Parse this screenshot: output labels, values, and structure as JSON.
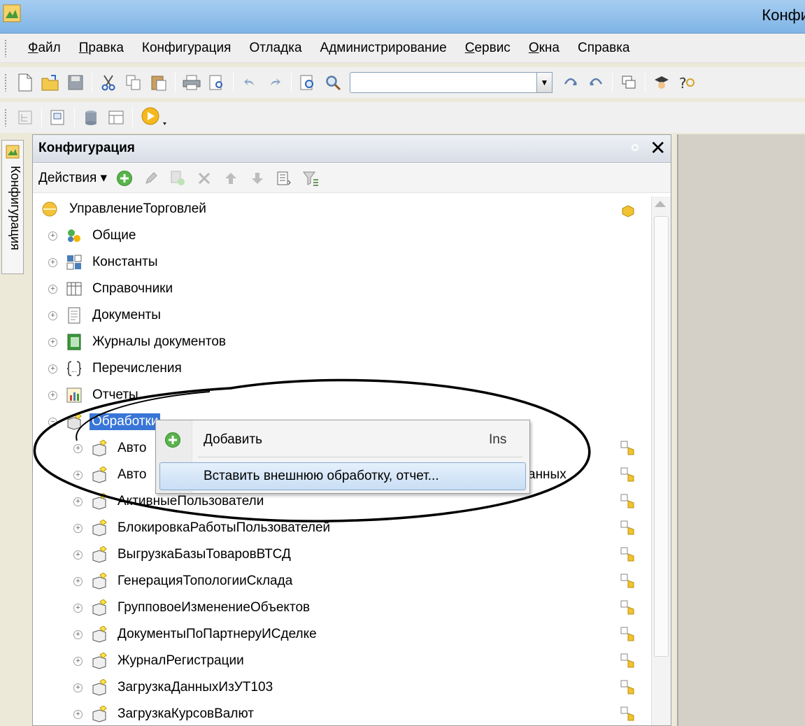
{
  "window": {
    "title": "Конфи"
  },
  "menu": {
    "items": [
      "Файл",
      "Правка",
      "Конфигурация",
      "Отладка",
      "Администрирование",
      "Сервис",
      "Окна",
      "Справка"
    ]
  },
  "sidebar": {
    "label": "Конфигурация"
  },
  "panel": {
    "title": "Конфигурация",
    "actions_label": "Действия ▾",
    "tree": {
      "root": "УправлениеТорговлей",
      "groups": [
        "Общие",
        "Константы",
        "Справочники",
        "Документы",
        "Журналы документов",
        "Перечисления",
        "Отчеты",
        "Обработки"
      ],
      "processings": [
        "Авто",
        "Авто",
        "АктивныеПользователи",
        "БлокировкаРаботыПользователей",
        "ВыгрузкаБазыТоваровВТСД",
        "ГенерацияТопологииСклада",
        "ГрупповоеИзменениеОбъектов",
        "ДокументыПоПартнеруИСделке",
        "ЖурналРегистрации",
        "ЗагрузкаДанныхИзУТ103",
        "ЗагрузкаКурсовВалют"
      ],
      "partial_suffix": "анных"
    }
  },
  "context_menu": {
    "add_label": "Добавить",
    "add_shortcut": "Ins",
    "insert_label": "Вставить внешнюю обработку, отчет..."
  },
  "colors": {
    "selection": "#3875d7",
    "highlight": "#c9def5",
    "titlebar": "#8fc0ea"
  }
}
